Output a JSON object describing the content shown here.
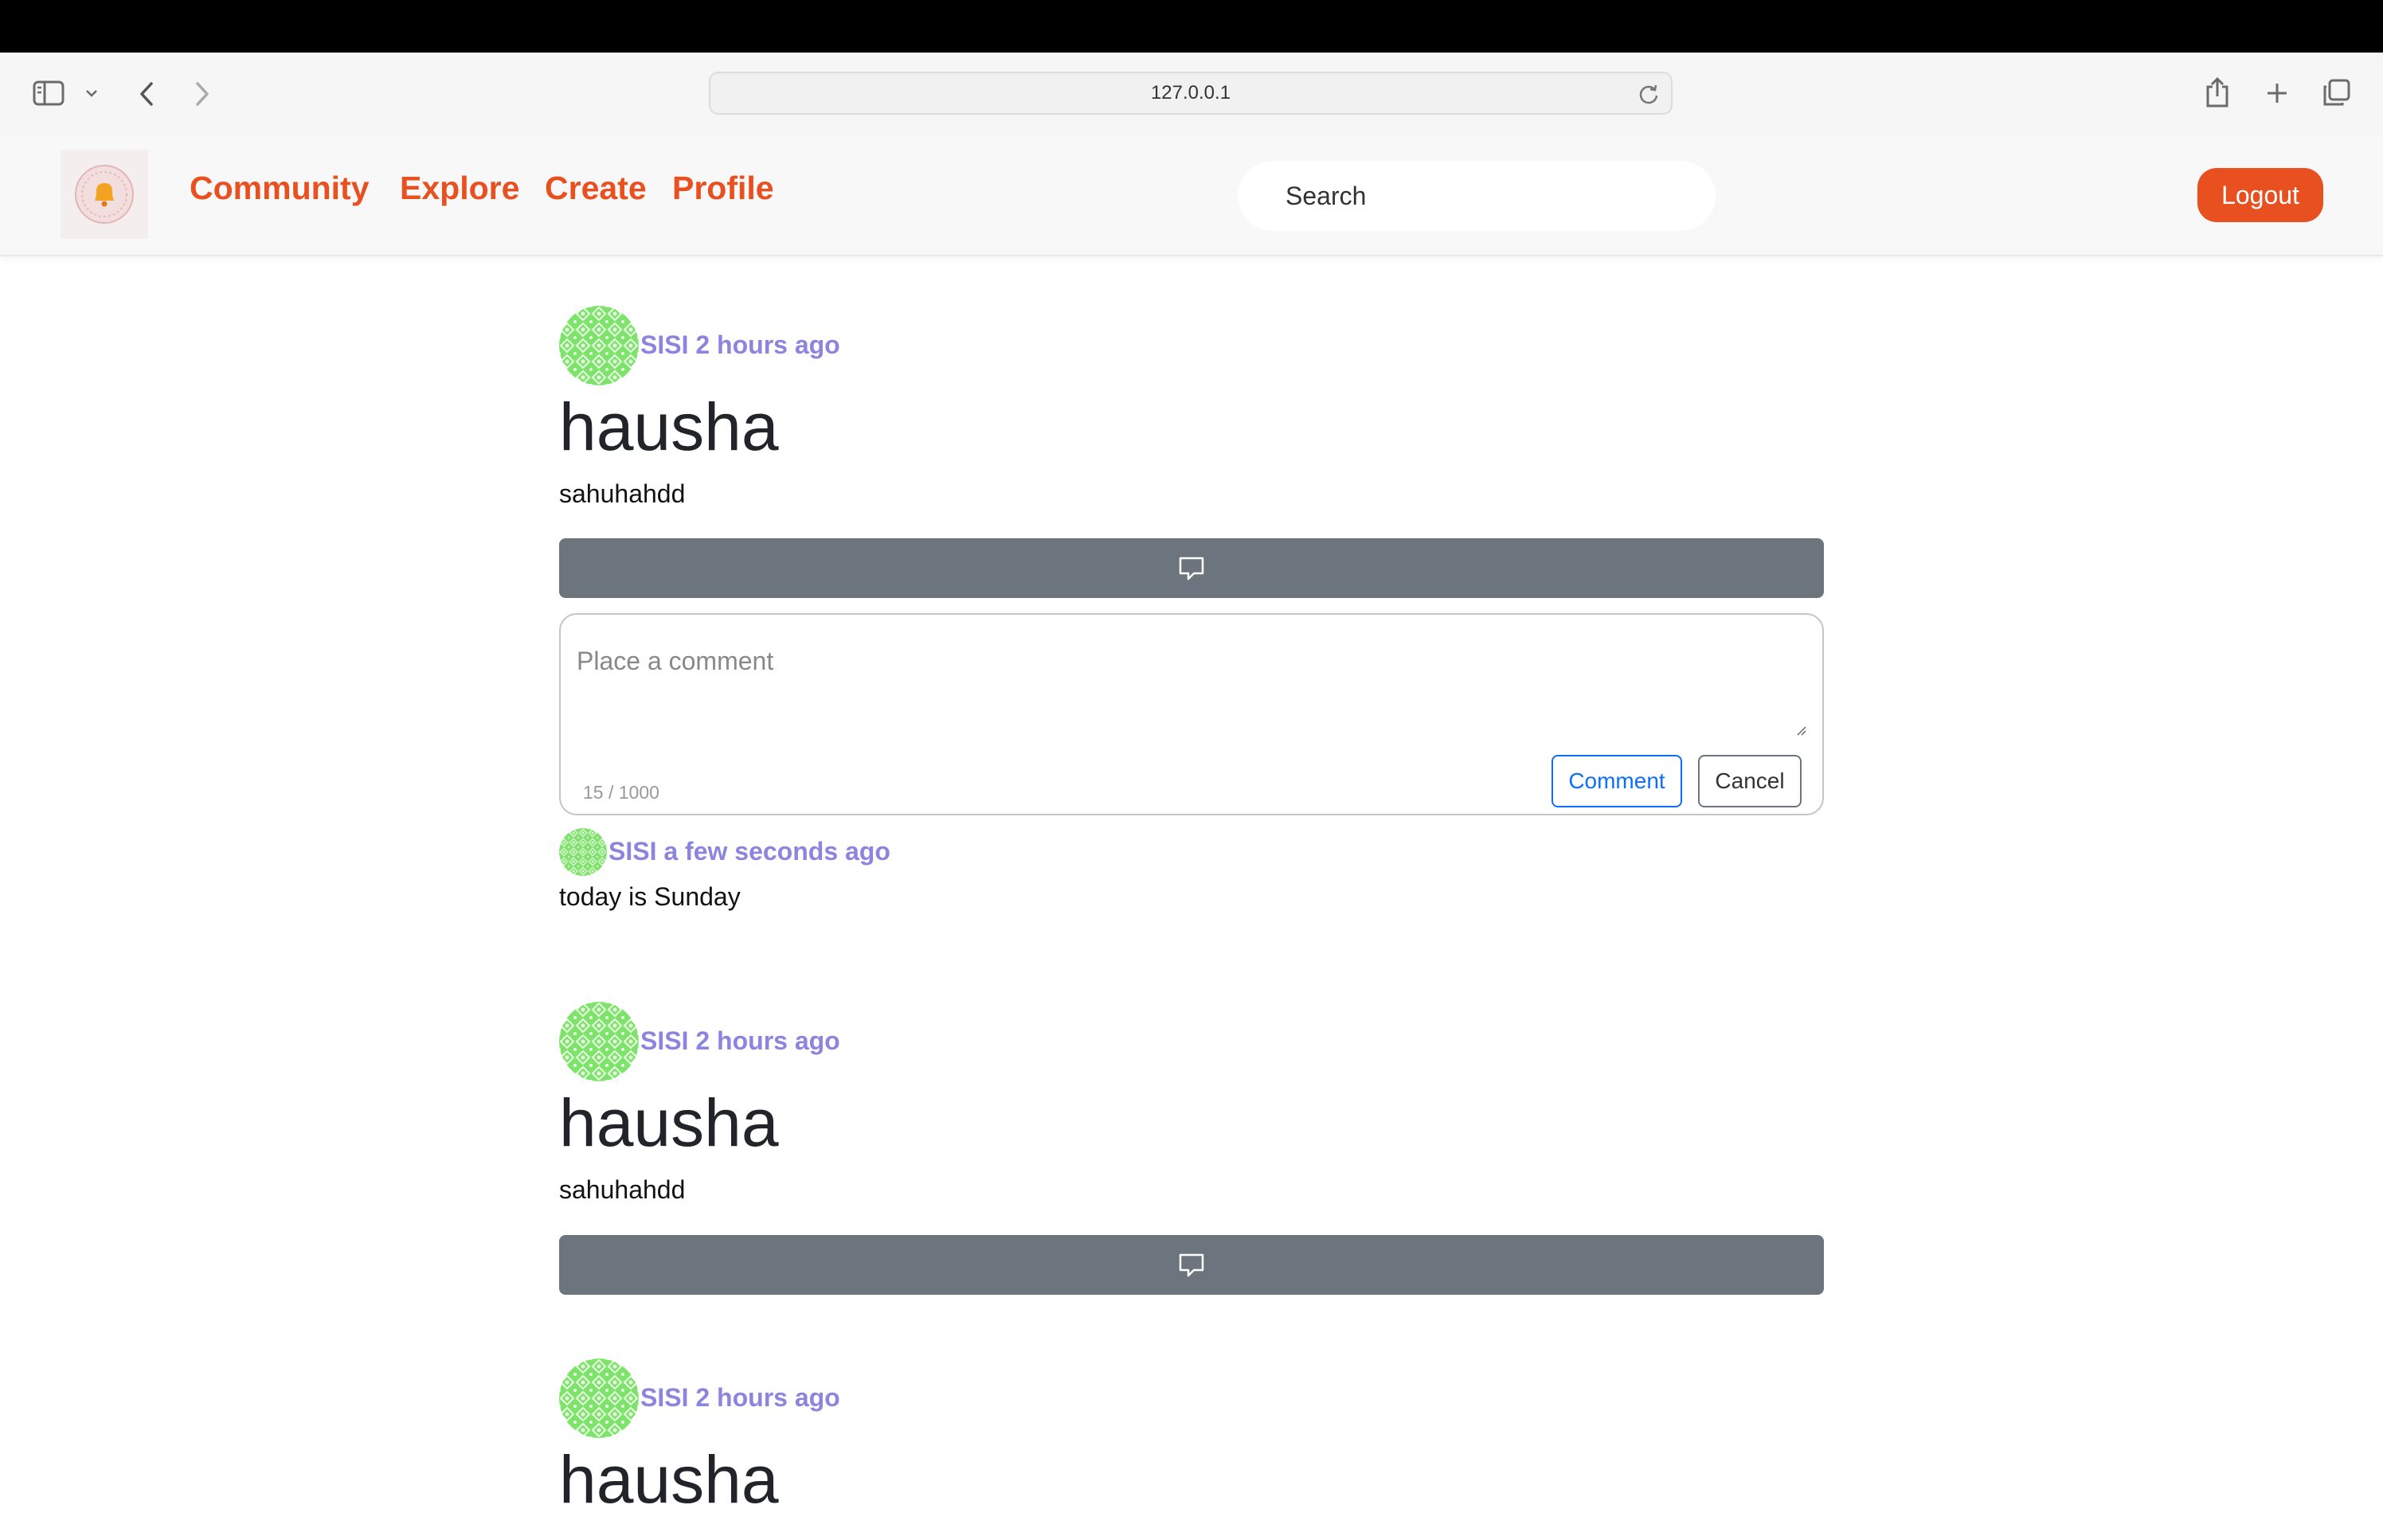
{
  "browser": {
    "url": "127.0.0.1",
    "icons": [
      "sidebar-icon",
      "chevron-down-icon",
      "back-icon",
      "forward-icon",
      "reload-icon",
      "share-icon",
      "new-tab-icon",
      "tabs-overview-icon"
    ]
  },
  "navbar": {
    "logo_icon": "bell-icon",
    "links": [
      "Community",
      "Explore",
      "Create",
      "Profile"
    ],
    "search_placeholder": "Search",
    "logout_label": "Logout",
    "accent_color": "#e8501f"
  },
  "posts": [
    {
      "author": "SISI",
      "time": "2 hours ago",
      "title": "hausha",
      "body": "sahuhahdd",
      "comment_form": {
        "placeholder": "Place a comment",
        "char_count": "15 / 1000",
        "submit_label": "Comment",
        "cancel_label": "Cancel"
      },
      "replies": [
        {
          "author": "SISI",
          "time": "a few seconds ago",
          "body": "today is Sunday"
        }
      ]
    },
    {
      "author": "SISI",
      "time": "2 hours ago",
      "title": "hausha",
      "body": "sahuhahdd"
    },
    {
      "author": "SISI",
      "time": "2 hours ago",
      "title": "hausha",
      "body": ""
    }
  ],
  "colors": {
    "author_link": "#8c85e0",
    "comment_bar": "#6c757d",
    "avatar_green": "#7ee36b"
  }
}
